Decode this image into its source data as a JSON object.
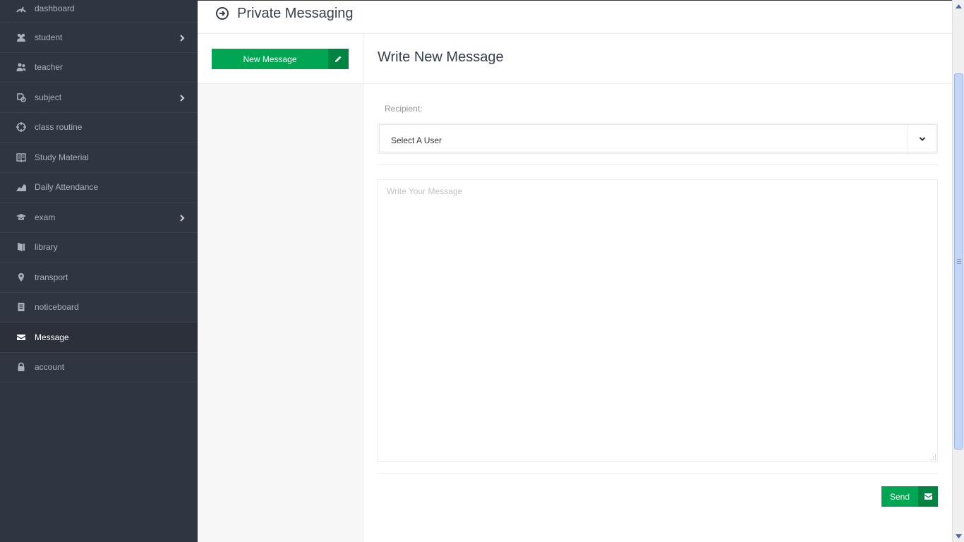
{
  "sidebar": {
    "items": [
      {
        "label": "dashboard",
        "icon": "dashboard-icon",
        "has_submenu": false,
        "active": false
      },
      {
        "label": "student",
        "icon": "users-icon",
        "has_submenu": true,
        "active": false
      },
      {
        "label": "teacher",
        "icon": "user-icon",
        "has_submenu": false,
        "active": false
      },
      {
        "label": "subject",
        "icon": "flow-tree-icon",
        "has_submenu": true,
        "active": false
      },
      {
        "label": "class routine",
        "icon": "target-icon",
        "has_submenu": false,
        "active": false
      },
      {
        "label": "Study Material",
        "icon": "book-open-icon",
        "has_submenu": false,
        "active": false
      },
      {
        "label": "Daily Attendance",
        "icon": "chart-area-icon",
        "has_submenu": false,
        "active": false
      },
      {
        "label": "exam",
        "icon": "graduation-cap-icon",
        "has_submenu": true,
        "active": false
      },
      {
        "label": "library",
        "icon": "book-icon",
        "has_submenu": false,
        "active": false
      },
      {
        "label": "transport",
        "icon": "location-icon",
        "has_submenu": false,
        "active": false
      },
      {
        "label": "noticeboard",
        "icon": "doc-text-icon",
        "has_submenu": false,
        "active": false
      },
      {
        "label": "Message",
        "icon": "mail-icon",
        "has_submenu": false,
        "active": true
      },
      {
        "label": "account",
        "icon": "lock-icon",
        "has_submenu": false,
        "active": false
      }
    ]
  },
  "header": {
    "title": "Private Messaging",
    "icon": "right-circled-icon"
  },
  "left_panel": {
    "new_message_label": "New Message",
    "new_message_icon": "pencil-icon"
  },
  "compose": {
    "title": "Write New Message",
    "recipient_label": "Recipient:",
    "recipient_value": "Select A User",
    "message_placeholder": "Write Your Message",
    "message_value": "",
    "send_label": "Send",
    "send_icon": "mail-icon"
  },
  "colors": {
    "sidebar_bg": "#303641",
    "accent_green": "#00a651",
    "accent_green_dark": "#008442"
  }
}
